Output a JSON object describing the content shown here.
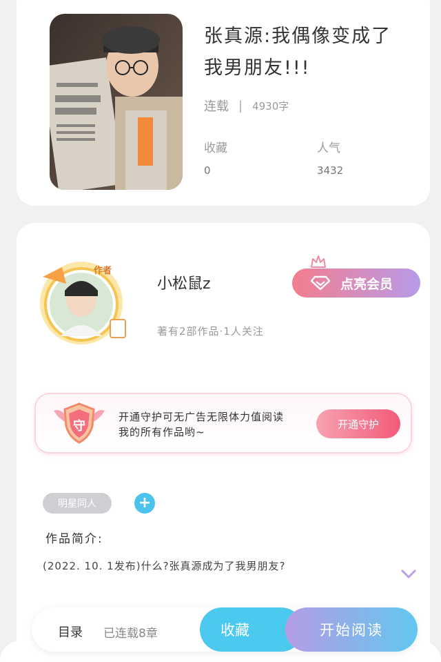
{
  "book": {
    "title": "张真源:我偶像变成了我男朋友!!!",
    "status": "连载",
    "separator": "|",
    "word_count": "4930字",
    "stats": [
      {
        "label": "收藏",
        "value": "0"
      },
      {
        "label": "人气",
        "value": "3432"
      }
    ]
  },
  "author": {
    "badge": "作者",
    "name": "小松鼠z",
    "subtitle": "著有2部作品·1人关注",
    "vip_button": "点亮会员"
  },
  "guard": {
    "icon_char": "守",
    "text": "开通守护可无广告无限体力值阅读我的所有作品哟~",
    "button": "开通守护"
  },
  "tags": [
    "明星同人"
  ],
  "intro": {
    "heading": "作品简介:",
    "text": "(2022. 10. 1发布)什么?张真源成为了我男朋友?"
  },
  "bottom_bar": {
    "toc_label": "目录",
    "chapter_count": "已连载8章",
    "favorite_button": "收藏",
    "read_button": "开始阅读"
  },
  "icons": {
    "vip": "diamond-icon",
    "crown": "crown-icon",
    "guard": "shield-icon",
    "add": "plus-icon",
    "expand": "chevron-down-icon"
  },
  "colors": {
    "accent_blue": "#4cc9ef",
    "accent_pink": "#f35a79",
    "accent_purple": "#b59ce4"
  }
}
